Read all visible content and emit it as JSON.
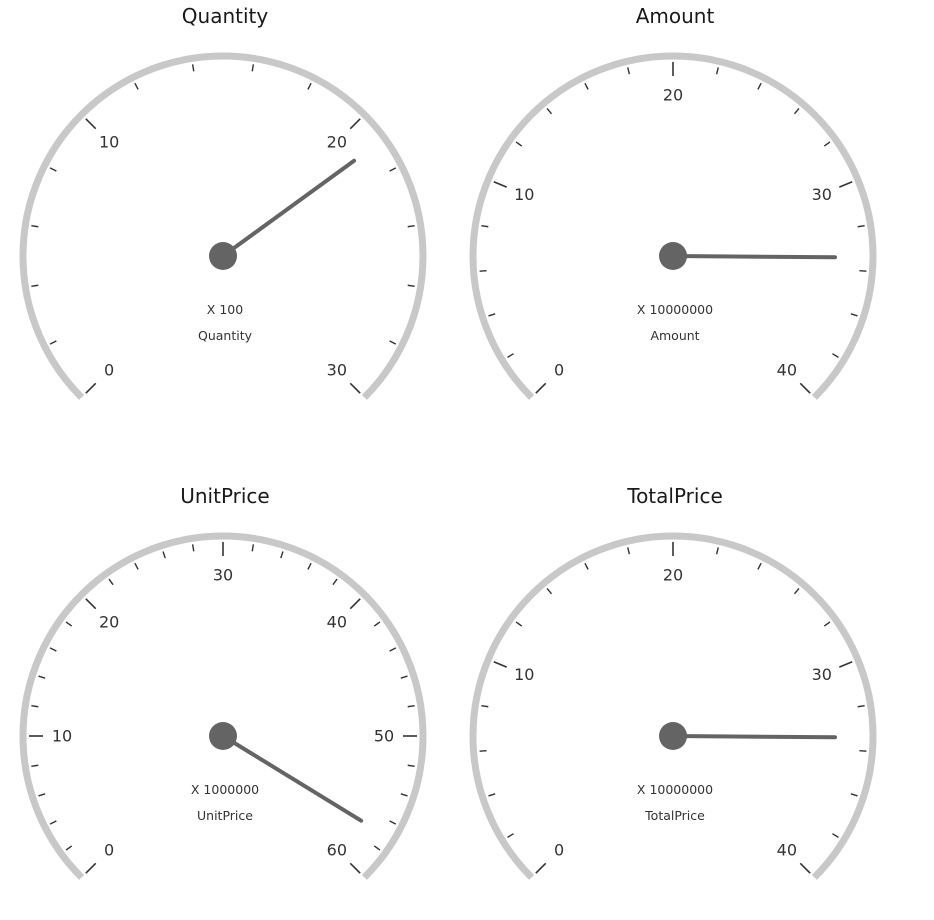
{
  "colors": {
    "rim": "#c8c8c8",
    "ticks": "#333333",
    "needle": "#646464",
    "text": "#333333"
  },
  "chart_data": [
    {
      "type": "gauge",
      "title": "Quantity",
      "min": 0,
      "max": 30,
      "major_step": 10,
      "minor_step": 2,
      "value": 21,
      "multiplier_text": "X 100",
      "label": "Quantity",
      "tick_labels": [
        "0",
        "10",
        "20",
        "30"
      ]
    },
    {
      "type": "gauge",
      "title": "Amount",
      "min": 0,
      "max": 40,
      "major_step": 10,
      "minor_step": 2,
      "value": 33.4,
      "multiplier_text": "X 10000000",
      "label": "Amount",
      "tick_labels": [
        "0",
        "10",
        "20",
        "30",
        "40"
      ]
    },
    {
      "type": "gauge",
      "title": "UnitPrice",
      "min": 0,
      "max": 60,
      "major_step": 10,
      "minor_step": 2,
      "value": 57,
      "multiplier_text": "X 1000000",
      "label": "UnitPrice",
      "tick_labels": [
        "0",
        "10",
        "20",
        "30",
        "40",
        "50",
        "60"
      ]
    },
    {
      "type": "gauge",
      "title": "TotalPrice",
      "min": 0,
      "max": 40,
      "major_step": 10,
      "minor_step": 2,
      "value": 33.4,
      "multiplier_text": "X 10000000",
      "label": "TotalPrice",
      "tick_labels": [
        "0",
        "10",
        "20",
        "30",
        "40"
      ]
    }
  ]
}
